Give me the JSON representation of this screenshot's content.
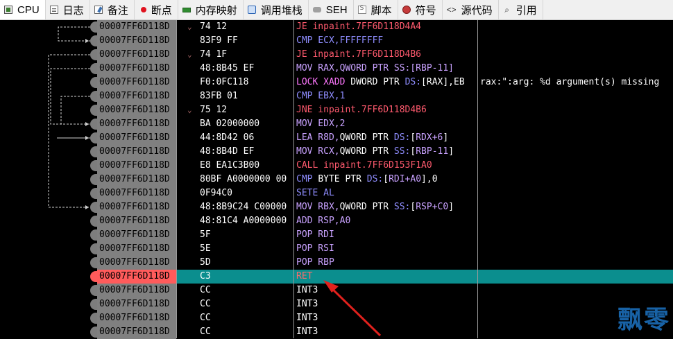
{
  "tabs": [
    {
      "label": "CPU",
      "icon": "cpu-icon"
    },
    {
      "label": "日志",
      "icon": "log-icon"
    },
    {
      "label": "备注",
      "icon": "notes-icon"
    },
    {
      "label": "断点",
      "icon": "breakpoint-icon"
    },
    {
      "label": "内存映射",
      "icon": "memory-map-icon"
    },
    {
      "label": "调用堆栈",
      "icon": "call-stack-icon"
    },
    {
      "label": "SEH",
      "icon": "seh-icon"
    },
    {
      "label": "脚本",
      "icon": "script-icon"
    },
    {
      "label": "符号",
      "icon": "symbols-icon"
    },
    {
      "label": "源代码",
      "icon": "source-icon"
    },
    {
      "label": "引用",
      "icon": "references-icon"
    }
  ],
  "disasm": {
    "rows": [
      {
        "addr": "00007FF6D118D",
        "fold": "⌄",
        "bytes": "74 12",
        "instr_html": "<span class='jmp'>JE inpaint.7FF6D118D4A4</span>"
      },
      {
        "addr": "00007FF6D118D",
        "fold": "",
        "bytes": "83F9 FF",
        "instr_html": "<span class='cmp'>CMP ECX,FFFFFFFF</span>"
      },
      {
        "addr": "00007FF6D118D",
        "fold": "⌄",
        "bytes": "74 1F",
        "instr_html": "<span class='jmp'>JE inpaint.7FF6D118D4B6</span>"
      },
      {
        "addr": "00007FF6D118D",
        "fold": "",
        "bytes": "48:8B45 EF",
        "instr_html": "<span class='mov'>MOV RAX,QWORD PTR SS:[RBP-11]</span>"
      },
      {
        "addr": "00007FF6D118D",
        "fold": "",
        "bytes": "F0:0FC118",
        "instr_html": "<span class='lock'>LOCK XADD</span> <span class='w'>DWORD PTR</span> <span class='seg'>DS:</span><span class='w'>[RAX],EB</span>",
        "comment": "rax:\":arg: %d argument(s) missing"
      },
      {
        "addr": "00007FF6D118D",
        "fold": "",
        "bytes": "83FB 01",
        "instr_html": "<span class='cmp'>CMP EBX,1</span>"
      },
      {
        "addr": "00007FF6D118D",
        "fold": "⌄",
        "bytes": "75 12",
        "instr_html": "<span class='jmp'>JNE inpaint.7FF6D118D4B6</span>"
      },
      {
        "addr": "00007FF6D118D",
        "fold": "",
        "bytes": "BA 02000000",
        "instr_html": "<span class='mov'>MOV EDX,2</span>"
      },
      {
        "addr": "00007FF6D118D",
        "fold": "",
        "bytes": "44:8D42 06",
        "instr_html": "<span class='mov'>LEA R8D,</span><span class='w'>QWORD PTR</span> <span class='seg'>DS:</span><span class='w'>[</span><span class='mov'>RDX+6</span><span class='w'>]</span>"
      },
      {
        "addr": "00007FF6D118D",
        "fold": "",
        "bytes": "48:8B4D EF",
        "instr_html": "<span class='mov'>MOV RCX,</span><span class='w'>QWORD PTR</span> <span class='seg'>SS:</span><span class='w'>[</span><span class='mov'>RBP-11</span><span class='w'>]</span>"
      },
      {
        "addr": "00007FF6D118D",
        "fold": "",
        "bytes": "E8 EA1C3B00",
        "instr_html": "<span class='call'>CALL inpaint.7FF6D153F1A0</span>"
      },
      {
        "addr": "00007FF6D118D",
        "fold": "",
        "bytes": "80BF A0000000 00",
        "instr_html": "<span class='cmp'>CMP</span> <span class='w'>BYTE PTR</span> <span class='seg'>DS:</span><span class='w'>[</span><span class='mov'>RDI+A0</span><span class='w'>],0</span>"
      },
      {
        "addr": "00007FF6D118D",
        "fold": "",
        "bytes": "0F94C0",
        "instr_html": "<span class='cmp'>SETE AL</span>"
      },
      {
        "addr": "00007FF6D118D",
        "fold": "",
        "bytes": "48:8B9C24 C00000",
        "instr_html": "<span class='mov'>MOV RBX,</span><span class='w'>QWORD PTR</span> <span class='seg'>SS:</span><span class='w'>[</span><span class='mov'>RSP+C0</span><span class='w'>]</span>"
      },
      {
        "addr": "00007FF6D118D",
        "fold": "",
        "bytes": "48:81C4 A0000000",
        "instr_html": "<span class='mov'>ADD RSP,A0</span>"
      },
      {
        "addr": "00007FF6D118D",
        "fold": "",
        "bytes": "5F",
        "instr_html": "<span class='pp'>POP RDI</span>"
      },
      {
        "addr": "00007FF6D118D",
        "fold": "",
        "bytes": "5E",
        "instr_html": "<span class='pp'>POP RSI</span>"
      },
      {
        "addr": "00007FF6D118D",
        "fold": "",
        "bytes": "5D",
        "instr_html": "<span class='pp'>POP RBP</span>"
      },
      {
        "addr": "00007FF6D118D",
        "fold": "",
        "bytes": "C3",
        "instr_html": "<span class='ret'>RET</span>",
        "selected": true,
        "current": true
      },
      {
        "addr": "00007FF6D118D",
        "fold": "",
        "bytes": "CC",
        "instr_html": "<span class='w'>INT3</span>"
      },
      {
        "addr": "00007FF6D118D",
        "fold": "",
        "bytes": "CC",
        "instr_html": "<span class='w'>INT3</span>"
      },
      {
        "addr": "00007FF6D118D",
        "fold": "",
        "bytes": "CC",
        "instr_html": "<span class='w'>INT3</span>"
      },
      {
        "addr": "00007FF6D118D",
        "fold": "",
        "bytes": "CC",
        "instr_html": "<span class='w'>INT3</span>"
      }
    ]
  },
  "watermark": "飘零",
  "colors": {
    "selected_addr_bg": "#ff5b5b",
    "current_row_bg": "#0b8e8e",
    "jump_color": "#ff5a6e",
    "cmp_color": "#8f8dff",
    "mov_color": "#c9a2ff"
  }
}
